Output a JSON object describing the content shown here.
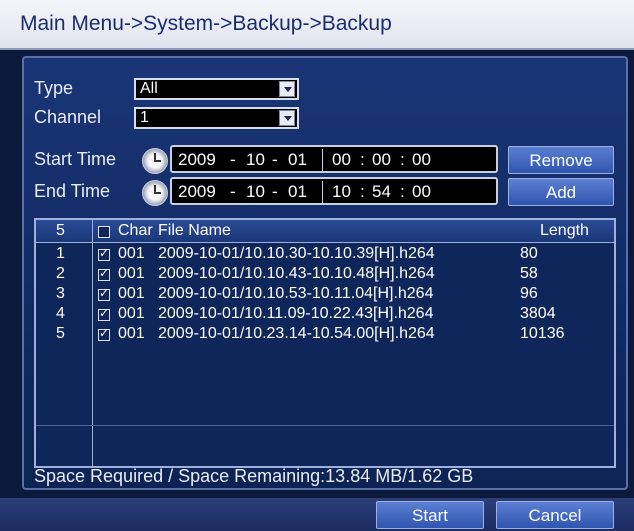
{
  "title": "Main Menu->System->Backup->Backup",
  "form": {
    "type_label": "Type",
    "type_value": "All",
    "channel_label": "Channel",
    "channel_value": "1",
    "start_label": "Start Time",
    "end_label": "End Time",
    "start": {
      "year": "2009",
      "month": "10",
      "day": "01",
      "hh": "00",
      "mm": "00",
      "ss": "00"
    },
    "end": {
      "year": "2009",
      "month": "10",
      "day": "01",
      "hh": "10",
      "mm": "54",
      "ss": "00"
    },
    "date_sep": "-",
    "time_sep": ":"
  },
  "buttons": {
    "remove": "Remove",
    "add": "Add",
    "start": "Start",
    "cancel": "Cancel"
  },
  "table": {
    "count": "5",
    "col_char": "Char",
    "col_file": "File Name",
    "col_length": "Length",
    "rows": [
      {
        "idx": "1",
        "char": "001",
        "file": "2009-10-01/10.10.30-10.10.39[H].h264",
        "length": "80"
      },
      {
        "idx": "2",
        "char": "001",
        "file": "2009-10-01/10.10.43-10.10.48[H].h264",
        "length": "58"
      },
      {
        "idx": "3",
        "char": "001",
        "file": "2009-10-01/10.10.53-10.11.04[H].h264",
        "length": "96"
      },
      {
        "idx": "4",
        "char": "001",
        "file": "2009-10-01/10.11.09-10.22.43[H].h264",
        "length": "3804"
      },
      {
        "idx": "5",
        "char": "001",
        "file": "2009-10-01/10.23.14-10.54.00[H].h264",
        "length": "10136"
      }
    ]
  },
  "space_text": "Space Required / Space Remaining:13.84 MB/1.62 GB"
}
